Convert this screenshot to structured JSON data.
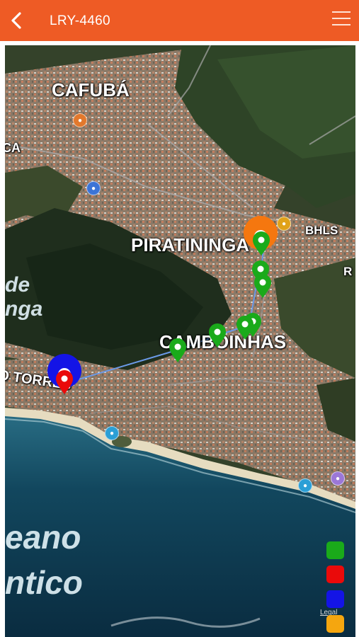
{
  "header": {
    "title": "LRY-4460",
    "back_icon": "chevron-left-icon",
    "menu_icon": "hamburger-menu-icon",
    "background": "#ee5b25"
  },
  "map": {
    "type": "satellite",
    "labels": {
      "cafuba": "CAFUBÁ",
      "piratininga": "PIRATININGA",
      "camboinhas": "CAMBOINHAS",
      "bhls": "BHLS",
      "tores": "O TORRES",
      "ca": "CA",
      "r": "R",
      "lagoon_1": "de",
      "lagoon_2": "nga",
      "ocean_1": "eano",
      "ocean_2": "ntico"
    },
    "route_color": "#6b9ae8",
    "legend_colors": {
      "green": "#1aaa1a",
      "red": "#ea0a0a",
      "blue": "#1414e6",
      "orange": "#f5a60f"
    },
    "legal": "Legal"
  }
}
